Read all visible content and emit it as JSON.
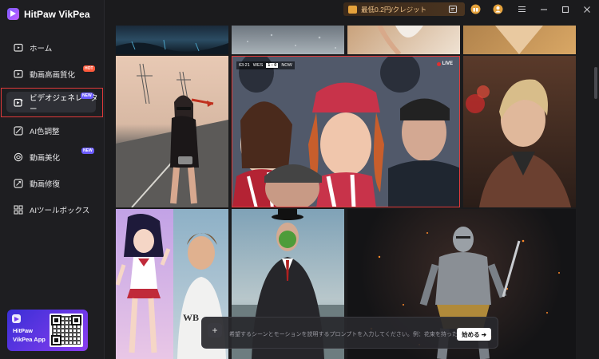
{
  "app": {
    "title": "HitPaw VikPea"
  },
  "sidebar": {
    "items": [
      {
        "label": "ホーム",
        "icon": "home-icon"
      },
      {
        "label": "動画高画質化",
        "icon": "video-enhance-icon",
        "badge": "HOT"
      },
      {
        "label": "ビデオジェネレーター",
        "icon": "video-generator-icon",
        "badge": "NEW"
      },
      {
        "label": "AI色調整",
        "icon": "color-adjust-icon"
      },
      {
        "label": "動画美化",
        "icon": "beautify-icon",
        "badge": "NEW"
      },
      {
        "label": "動画修復",
        "icon": "repair-icon"
      },
      {
        "label": "AIツールボックス",
        "icon": "toolbox-icon"
      }
    ],
    "promo": {
      "line1": "HitPaw",
      "line2": "VikPea App"
    }
  },
  "topbar": {
    "credit_label": "最低0.2円/クレジット"
  },
  "gallery": {
    "sport_tile": {
      "clock": "63:21",
      "team_home": "WES",
      "score": "1 : 0",
      "team_away": "NOW",
      "live": "LIVE"
    }
  },
  "prompt": {
    "placeholder": "希望するシーンとモーションを説明するプロンプトを入力してください。例：花束を持った3Dの女の子。",
    "start_label": "始める ➔"
  },
  "colors": {
    "accent": "#e03a3a",
    "brand": "#7b5cff",
    "sidebar_bg": "#1e1e21",
    "credit_text": "#f0c48a"
  }
}
